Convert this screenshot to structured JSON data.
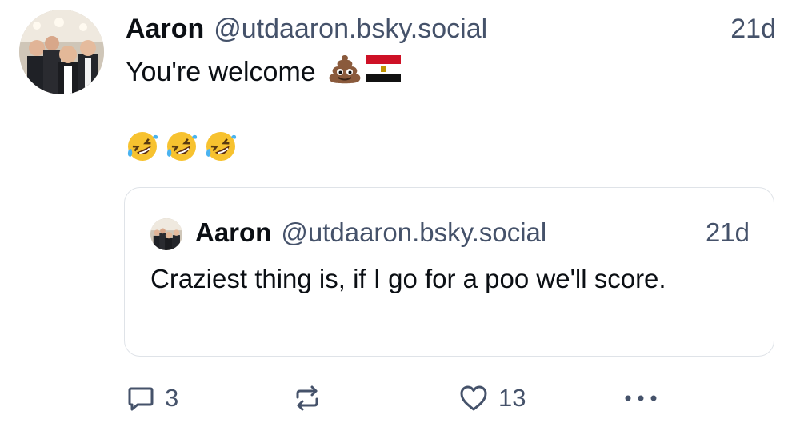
{
  "post": {
    "author_name": "Aaron",
    "author_handle": "@utdaaron.bsky.social",
    "time": "21d",
    "text_line1": "You're welcome",
    "text_line1_emojis": [
      "pile-of-poo-emoji",
      "egypt-flag-emoji"
    ],
    "text_line2_emojis": [
      "rolling-on-floor-laughing-emoji",
      "rolling-on-floor-laughing-emoji",
      "rolling-on-floor-laughing-emoji"
    ]
  },
  "quote": {
    "author_name": "Aaron",
    "author_handle": "@utdaaron.bsky.social",
    "time": "21d",
    "text": "Craziest thing is, if I go for a poo we'll score."
  },
  "actions": {
    "reply_count": "3",
    "repost_count": "",
    "like_count": "13"
  },
  "icons": {
    "reply": "speech-bubble-icon",
    "repost": "repost-arrows-icon",
    "like": "heart-icon",
    "more": "ellipsis-icon"
  },
  "colors": {
    "text": "#0b0f14",
    "muted": "#45526a",
    "border": "#dfe3e8",
    "background": "#ffffff"
  }
}
